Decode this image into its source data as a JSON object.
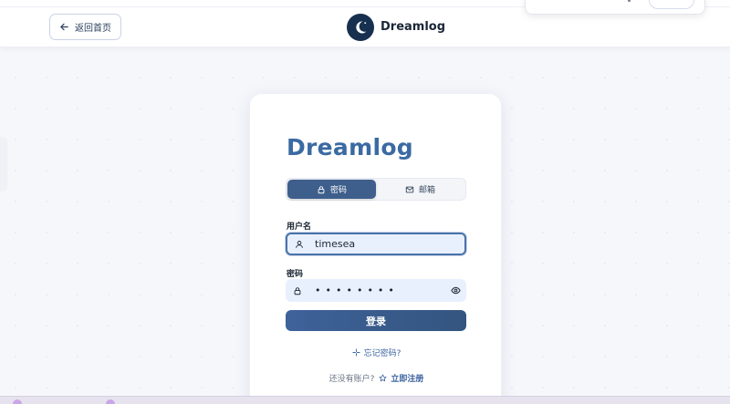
{
  "header": {
    "back_label": "返回首页",
    "brand_name": "Dreamlog"
  },
  "login": {
    "title": "Dreamlog",
    "tabs": [
      {
        "label": "密码",
        "icon": "lock-icon",
        "active": true
      },
      {
        "label": "邮箱",
        "icon": "mail-icon",
        "active": false
      }
    ],
    "username_label": "用户名",
    "username_value": "timesea",
    "password_label": "密码",
    "password_mask": "••••••••",
    "submit_label": "登录",
    "forgot_label": "忘记密码?",
    "no_account_text": "还没有账户?",
    "signup_label": "立即注册"
  },
  "colors": {
    "accent": "#3e5f8c",
    "title": "#3b6aa3",
    "link": "#3c64a0",
    "input_bg": "#e8f0fe"
  }
}
